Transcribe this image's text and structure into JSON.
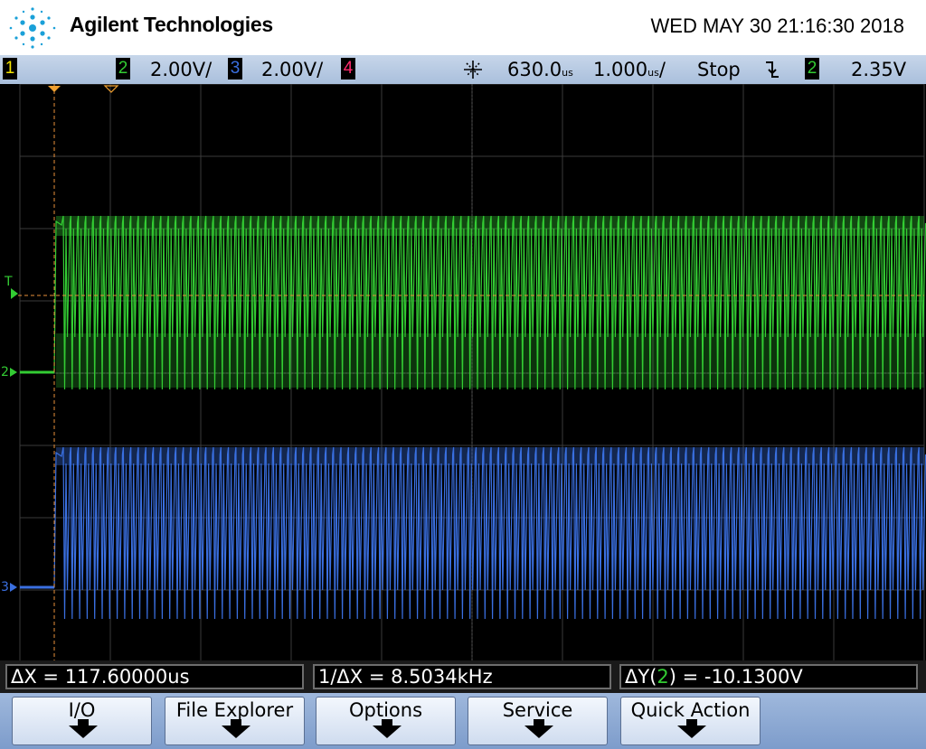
{
  "header": {
    "brand": "Agilent Technologies",
    "datetime": "WED MAY 30 21:16:30 2018"
  },
  "statusbar": {
    "ch1_num": "1",
    "ch2_num": "2",
    "ch2_scale": "2.00V/",
    "ch3_num": "3",
    "ch3_scale": "2.00V/",
    "ch4_num": "4",
    "time_icon": "acquisition-star-icon",
    "delay": "630.0",
    "delay_unit": "us",
    "timebase": "1.000",
    "timebase_unit": "us",
    "timebase_suffix": "/",
    "run_state": "Stop",
    "trigger_slope_icon": "falling-edge-icon",
    "trigger_source": "2",
    "trigger_level": "2.35V",
    "colors": {
      "ch1": "#f5e400",
      "ch2": "#33cc33",
      "ch3": "#3a6fe0",
      "ch4": "#ff2a6d"
    }
  },
  "screen": {
    "markers": {
      "trigger": "T",
      "ch2": "2",
      "ch3": "3"
    }
  },
  "cursors": {
    "dx": "ΔX = 117.60000us",
    "inv_dx": "1/ΔX = 8.5034kHz",
    "dy_prefix": "ΔY(",
    "dy_channel": "2",
    "dy_suffix": ") = -10.1300V"
  },
  "softkeys": [
    {
      "label": "I/O"
    },
    {
      "label": "File Explorer"
    },
    {
      "label": "Options"
    },
    {
      "label": "Service"
    },
    {
      "label": "Quick Action"
    }
  ]
}
